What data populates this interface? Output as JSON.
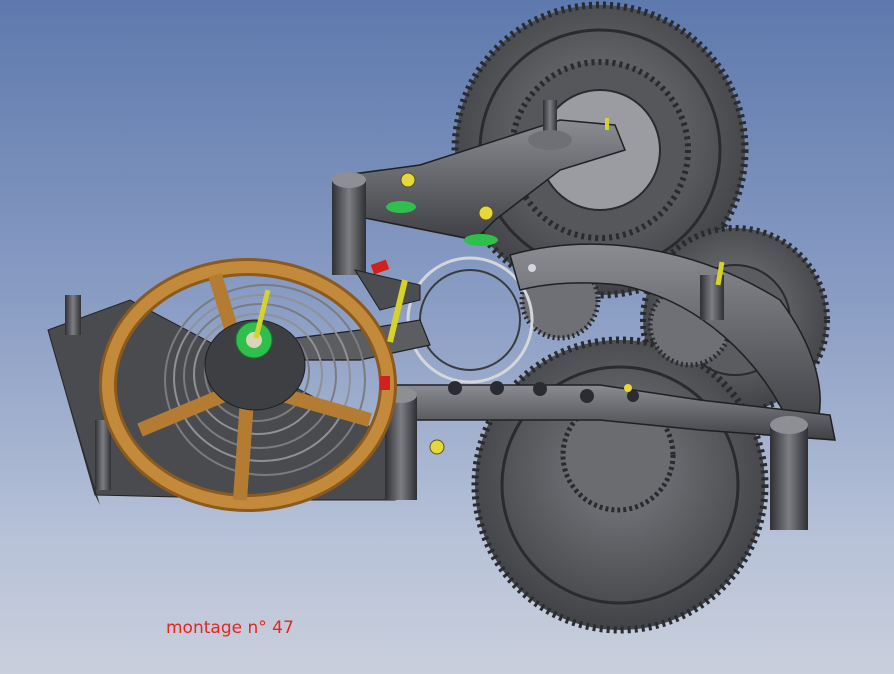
{
  "caption": {
    "text": "montage n° 47"
  },
  "colors": {
    "background_top": "#5e79ad",
    "background_bottom": "#c9cfdc",
    "metal_dark": "#3c3d40",
    "metal_mid": "#6b6d72",
    "metal_light": "#a9abb0",
    "balance_wheel": "#b47c33",
    "pin_yellow": "#d6d12b",
    "collet_green": "#2fbf4c",
    "pallet_red": "#d2201c",
    "caption": "#e8241f"
  },
  "parts": {
    "balance_wheel": "balance-wheel",
    "hairspring": "hairspring",
    "escape_wheel": "escape-wheel",
    "pallet_fork": "pallet-fork",
    "gear_train": "gear-train",
    "bridges": "bridges",
    "pillars": "pillars",
    "screws": "screws"
  }
}
